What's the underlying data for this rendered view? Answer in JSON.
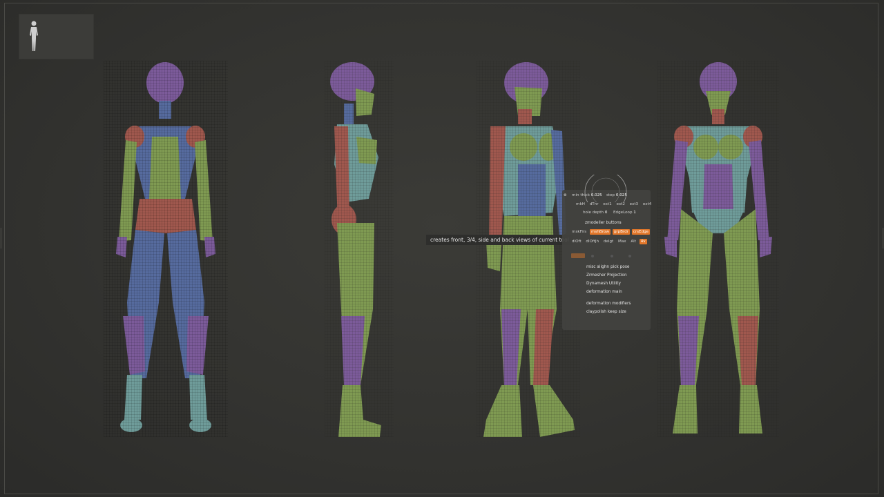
{
  "tooltip": "creates front, 3/4, side and back views of current tool",
  "panel": {
    "sliders": [
      {
        "label": "min thick",
        "value": "0.025"
      },
      {
        "label": "step",
        "value": "0.025"
      }
    ],
    "row_ext": [
      "mkH",
      "dTnr",
      "ext1",
      "ext2",
      "ext3",
      "ext4"
    ],
    "row_hole": [
      {
        "label": "hole depth",
        "value": "0"
      },
      {
        "label": "EdgeLoop",
        "value": "1"
      }
    ],
    "section_title": "zmodeller buttons",
    "row_buttons": [
      {
        "label": "mskFirs",
        "active": false
      },
      {
        "label": "mshBrow",
        "active": true
      },
      {
        "label": "grpBrdr",
        "active": true
      },
      {
        "label": "crsEdge",
        "active": true
      }
    ],
    "row_misc": [
      {
        "label": "dlOft",
        "active": false
      },
      {
        "label": "dlOftJh",
        "active": false
      },
      {
        "label": "delgt",
        "active": false
      },
      {
        "label": "Max",
        "active": false
      },
      {
        "label": "Alt",
        "active": false
      },
      {
        "label": "4v",
        "active": true
      }
    ],
    "menu": [
      "misc alighn pick pose",
      "Zrmesher Projection",
      "Dynamesh Utility",
      "deformation main",
      "deformation modifiers",
      "claypolish keep size"
    ]
  },
  "colors": {
    "green": "#7f9a52",
    "purple": "#7c5b9a",
    "teal": "#6f9c9a",
    "red": "#a0584e",
    "blue": "#566b9e",
    "highlight": "#e2772a"
  },
  "icons": {
    "thumbnail": "human-figure-icon",
    "panel_close": "close-icon",
    "brush_cursor": "brush-circle-icon"
  }
}
